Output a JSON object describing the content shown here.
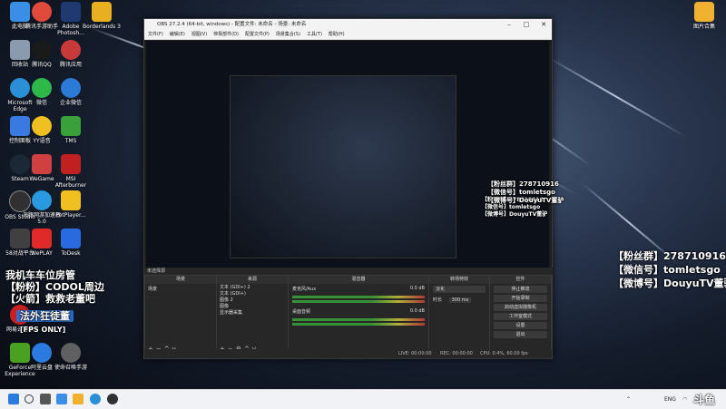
{
  "desktop": {
    "icons": [
      {
        "label": "此电脑",
        "color": "#3a8ee6"
      },
      {
        "label": "腾讯手游助手",
        "color": "#e04a3a"
      },
      {
        "label": "Adobe Photosh...",
        "color": "#1e3a70"
      },
      {
        "label": "Borderlands 3",
        "color": "#e8b020"
      },
      {
        "label": "回收站",
        "color": "#8a9bb0"
      },
      {
        "label": "腾讯QQ",
        "color": "#1a1a1a"
      },
      {
        "label": "腾讯应用",
        "color": "#c83a3a"
      },
      {
        "label": "Microsoft Edge",
        "color": "#2a8fd6"
      },
      {
        "label": "微信",
        "color": "#2fb84a"
      },
      {
        "label": "企业微信",
        "color": "#2a7ad6"
      },
      {
        "label": "控制面板",
        "color": "#3a7ae0"
      },
      {
        "label": "YY语音",
        "color": "#f0c020"
      },
      {
        "label": "TMS",
        "color": "#3aa03a"
      },
      {
        "label": "Steam",
        "color": "#1b2838"
      },
      {
        "label": "WeGame",
        "color": "#d04040"
      },
      {
        "label": "MSI Afterburner",
        "color": "#c02020"
      },
      {
        "label": "OBS Studio",
        "color": "#303030"
      },
      {
        "label": "海豚网游加速器5.0",
        "color": "#2a9ae0"
      },
      {
        "label": "PotPlayer...",
        "color": "#f0c020"
      },
      {
        "label": "58对战平台",
        "color": "#404040"
      },
      {
        "label": "WePLAY",
        "color": "#e02a2a"
      },
      {
        "label": "ToDesk",
        "color": "#2a6ae0"
      },
      {
        "label": "网易云音乐",
        "color": "#c82020"
      },
      {
        "label": "GeForce Experience",
        "color": "#4aa020"
      },
      {
        "label": "阿里云盘",
        "color": "#2a7ae0"
      },
      {
        "label": "使命召唤手游",
        "color": "#606060"
      }
    ],
    "right_icon": {
      "label": "图片合集",
      "color": "#f0b030"
    }
  },
  "obs": {
    "title": "OBS 27.2.4 (64-bit, windows) - 配置文件: 未命名 - 场景: 未命名",
    "menu": [
      "文件(F)",
      "编辑(E)",
      "视图(V)",
      "停靠部件(D)",
      "配置文件(P)",
      "场景集合(S)",
      "工具(T)",
      "帮助(H)"
    ],
    "no_source": "未选择源",
    "docks": {
      "scenes": {
        "title": "场景",
        "items": [
          "场景"
        ]
      },
      "sources": {
        "title": "来源",
        "items": [
          "文本 (GDI+) 2",
          "文本 (GDI+)",
          "图像 2",
          "图像",
          "显示器采集"
        ]
      },
      "mixer": {
        "title": "混音器",
        "channels": [
          {
            "name": "麦克风/Aux",
            "db": "0.0 dB"
          },
          {
            "name": "桌面音频",
            "db": "0.0 dB"
          }
        ]
      },
      "transitions": {
        "title": "转场特效",
        "type": "淡化",
        "duration_label": "时长",
        "duration": "300 ms"
      },
      "controls": {
        "title": "控件",
        "buttons": [
          "停止推流",
          "开始录制",
          "启动虚拟摄像机",
          "工作室模式",
          "设置",
          "退出"
        ]
      }
    },
    "status": {
      "live": "LIVE: 00:00:00",
      "rec": "REC: 00:00:00",
      "cpu": "CPU: 0.4%, 60.00 fps"
    }
  },
  "overlay": {
    "fans_group": "【粉丝群】278710916",
    "wechat": "【微信号】tomletsgo",
    "weibo": "【微博号】DouyuTV董驴",
    "left_lines": [
      "我机车车位房管",
      "【粉粉】CODOL周边",
      "【火箭】救救老董吧"
    ],
    "banner": "法外狂徒董",
    "fps_label": "[FPS ONLY]"
  },
  "taskbar": {
    "lang": "ENG",
    "watermark": "斗鱼"
  }
}
